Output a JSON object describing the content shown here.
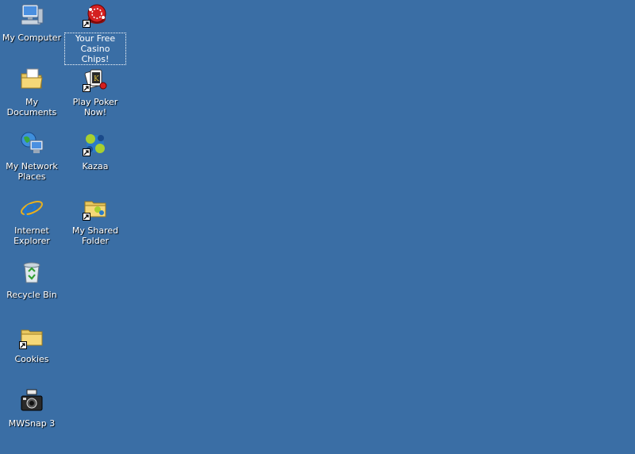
{
  "desktop": {
    "background_color": "#3a6ea5",
    "icons": [
      {
        "label": "My Computer",
        "icon": "my-computer-icon"
      },
      {
        "label": "Your Free\nCasino Chips!",
        "icon": "casino-chips-icon",
        "shortcut": true,
        "focused": true
      },
      {
        "label": "My Documents",
        "icon": "my-documents-icon"
      },
      {
        "label": "Play Poker\nNow!",
        "icon": "poker-cards-icon",
        "shortcut": true
      },
      {
        "label": "My Network\nPlaces",
        "icon": "network-places-icon"
      },
      {
        "label": "Kazaa",
        "icon": "kazaa-icon",
        "shortcut": true
      },
      {
        "label": "Internet\nExplorer",
        "icon": "internet-explorer-icon"
      },
      {
        "label": "My Shared\nFolder",
        "icon": "shared-folder-icon",
        "shortcut": true
      },
      {
        "label": "Recycle Bin",
        "icon": "recycle-bin-icon"
      },
      {
        "label": "Cookies",
        "icon": "cookies-folder-icon",
        "shortcut": true
      },
      {
        "label": "MWSnap 3",
        "icon": "camera-icon"
      }
    ]
  }
}
